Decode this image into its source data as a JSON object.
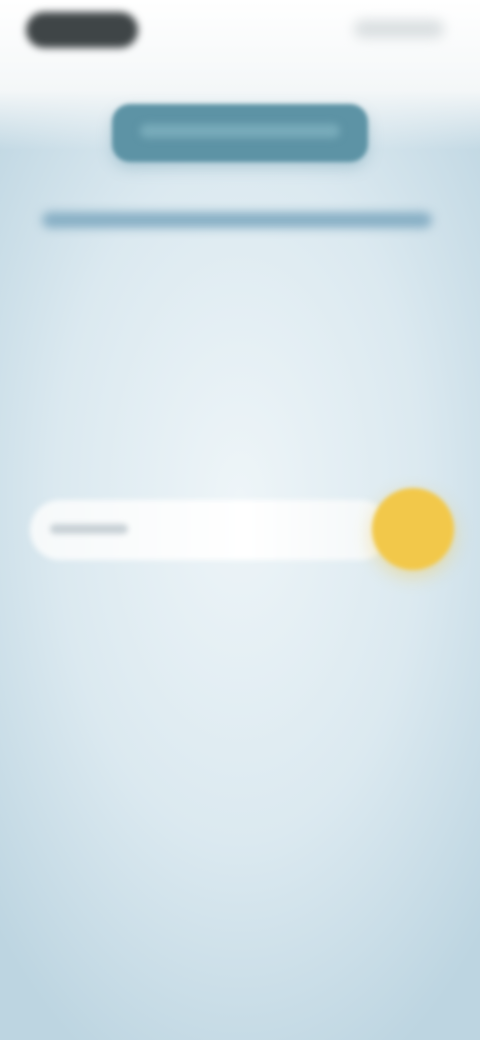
{
  "colors": {
    "primary_button": "#5d93a5",
    "accent_circle": "#f2c84a",
    "background": "#dbe9f0",
    "input_background": "#ffffff"
  }
}
